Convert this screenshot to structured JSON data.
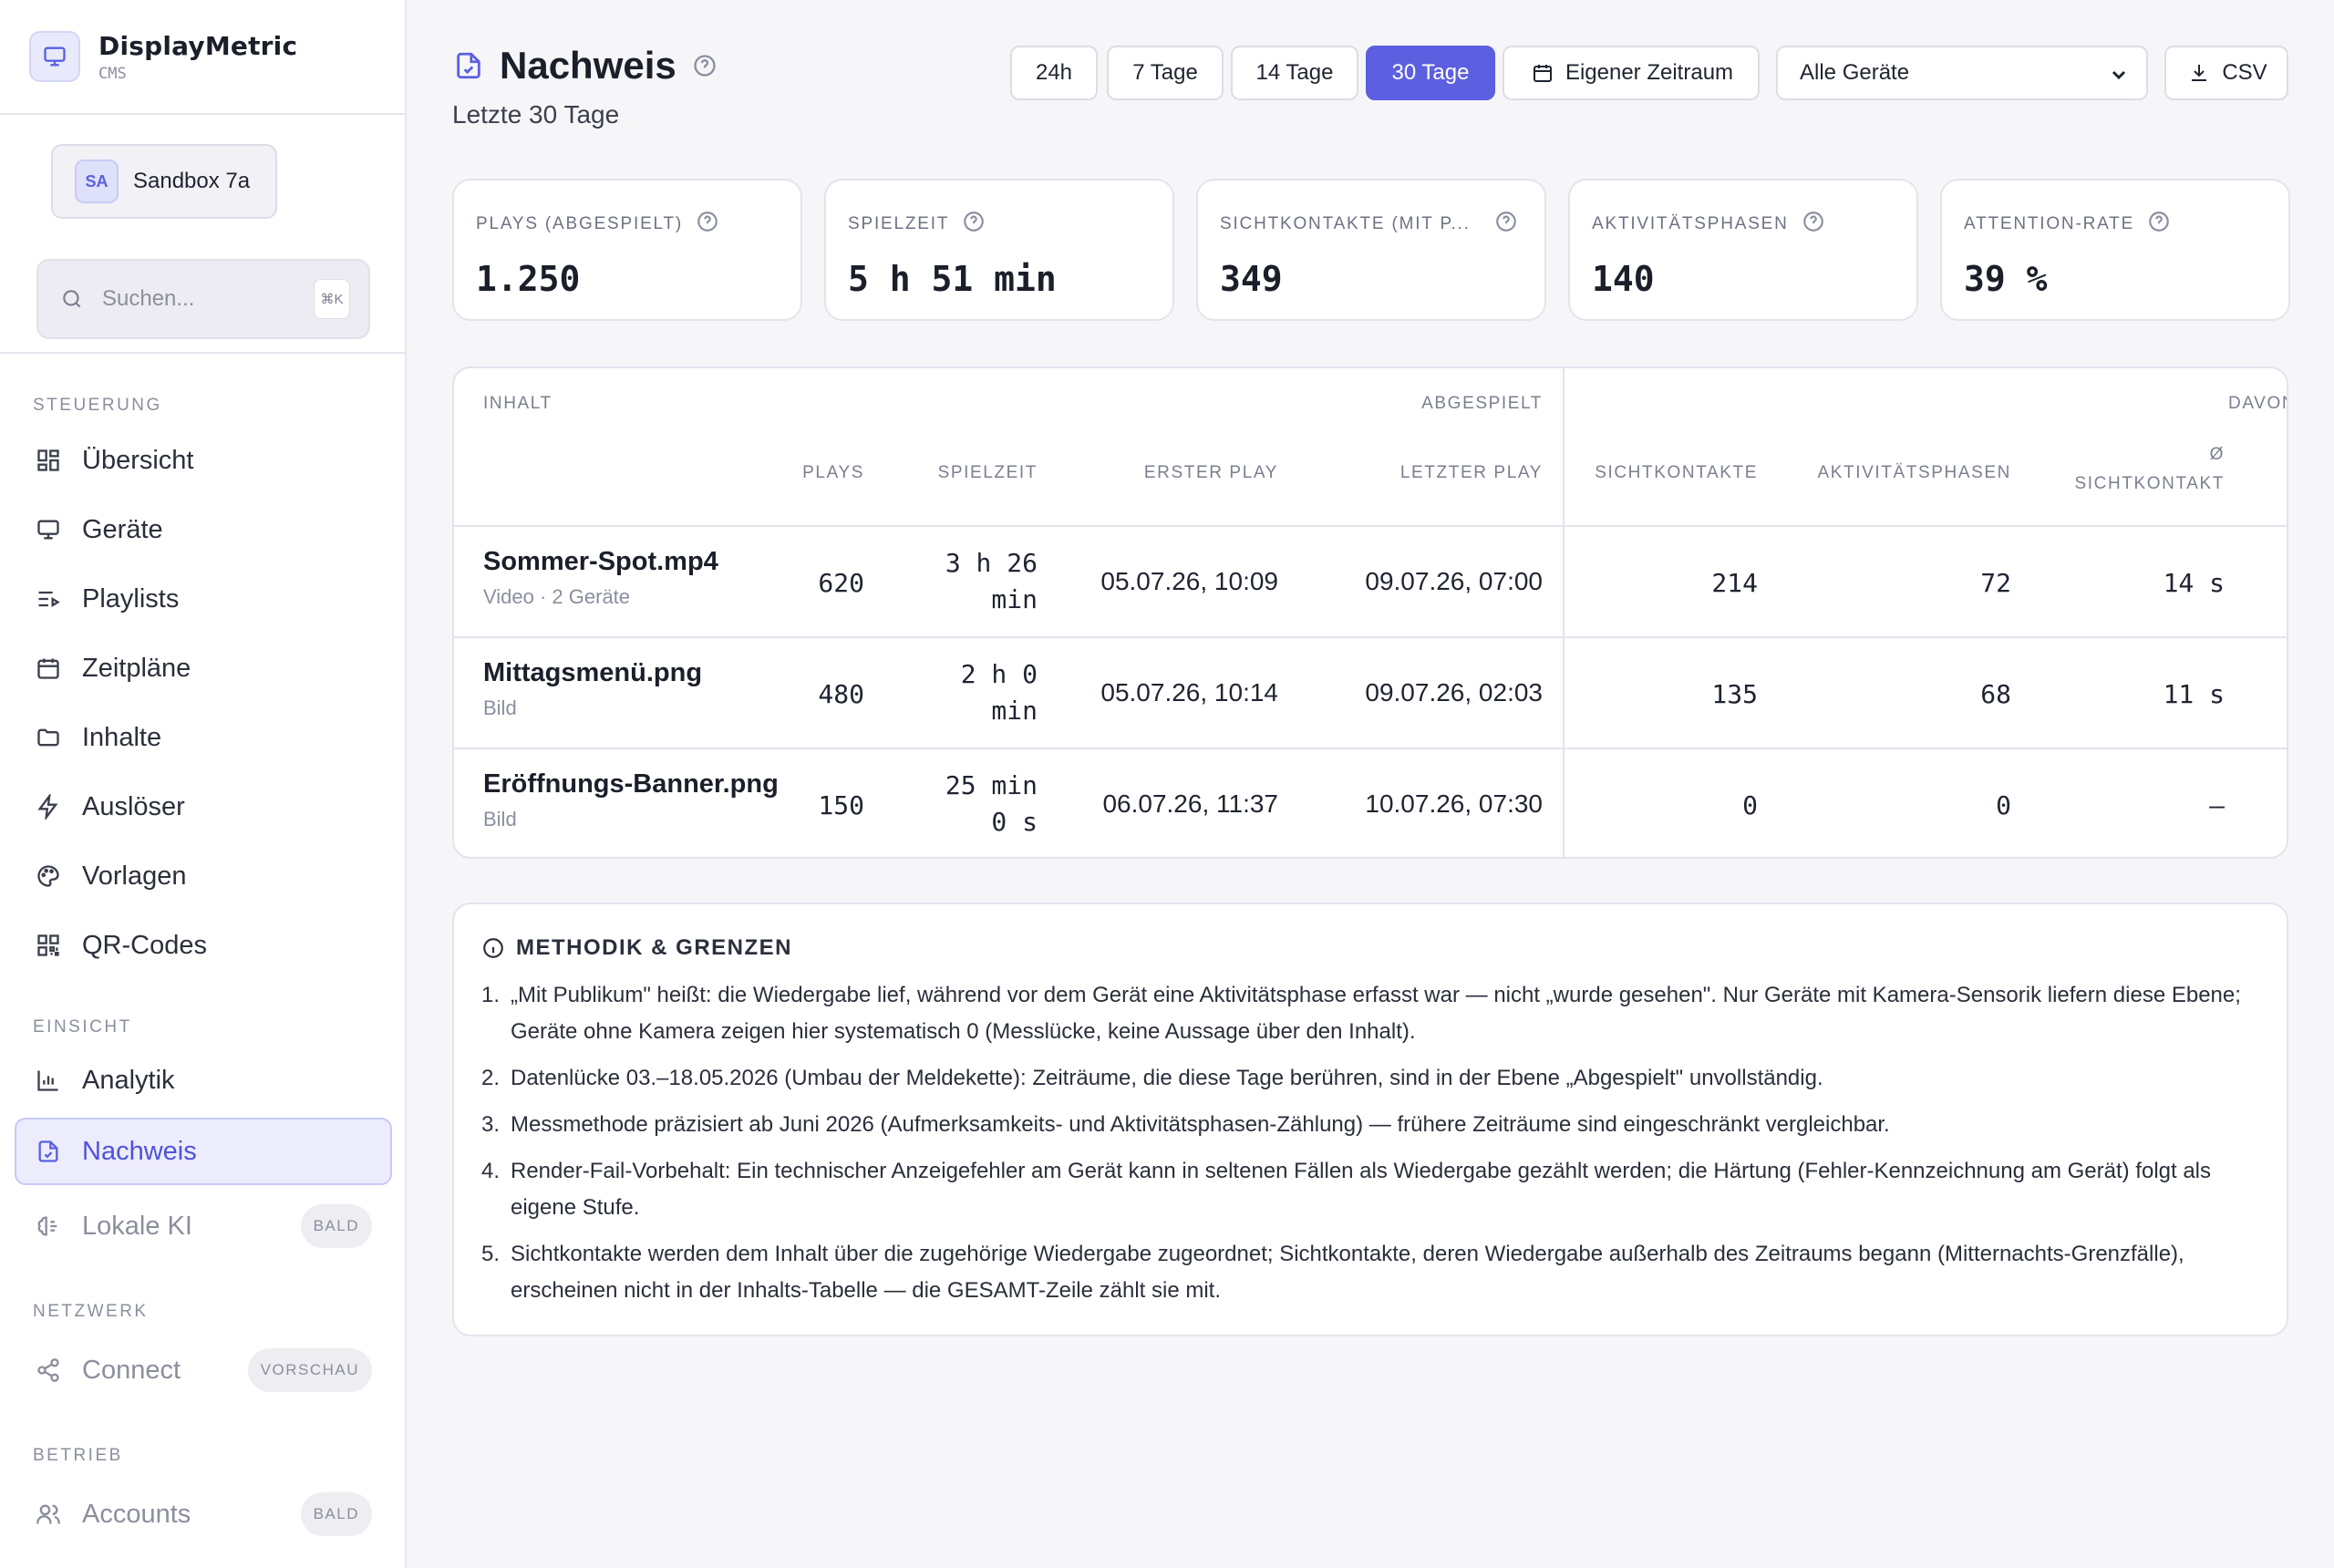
{
  "app": {
    "name": "DisplayMetric",
    "subtitle": "CMS",
    "workspace_initials": "SA",
    "workspace_name": "Sandbox 7a"
  },
  "search": {
    "placeholder": "Suchen...",
    "shortcut": "⌘K"
  },
  "sidebar": {
    "sections": [
      {
        "label": "STEUERUNG"
      },
      {
        "label": "EINSICHT"
      },
      {
        "label": "NETZWERK"
      },
      {
        "label": "BETRIEB"
      }
    ],
    "items": [
      {
        "label": "Übersicht",
        "icon": "grid-icon"
      },
      {
        "label": "Geräte",
        "icon": "monitor-icon"
      },
      {
        "label": "Playlists",
        "icon": "playlist-icon"
      },
      {
        "label": "Zeitpläne",
        "icon": "calendar-icon"
      },
      {
        "label": "Inhalte",
        "icon": "folder-icon"
      },
      {
        "label": "Auslöser",
        "icon": "lightning-icon"
      },
      {
        "label": "Vorlagen",
        "icon": "palette-icon"
      },
      {
        "label": "QR-Codes",
        "icon": "qr-icon"
      },
      {
        "label": "Analytik",
        "icon": "bar-chart-icon"
      },
      {
        "label": "Nachweis",
        "icon": "document-check-icon",
        "active": true
      },
      {
        "label": "Lokale KI",
        "icon": "brain-icon",
        "badge": "BALD"
      },
      {
        "label": "Connect",
        "icon": "share-icon",
        "badge": "VORSCHAU"
      },
      {
        "label": "Accounts",
        "icon": "users-icon",
        "badge": "BALD"
      }
    ]
  },
  "header": {
    "title": "Nachweis",
    "subtitle": "Letzte 30 Tage",
    "ranges": [
      "24h",
      "7 Tage",
      "14 Tage",
      "30 Tage"
    ],
    "active_range": "30 Tage",
    "custom_range": "Eigener Zeitraum",
    "device_filter": "Alle Geräte",
    "export": "CSV"
  },
  "kpis": [
    {
      "label": "PLAYS (ABGESPIELT)",
      "value": "1.250"
    },
    {
      "label": "SPIELZEIT",
      "value": "5 h 51 min"
    },
    {
      "label": "SICHTKONTAKTE (MIT P...",
      "value": "349"
    },
    {
      "label": "AKTIVITÄTSPHASEN",
      "value": "140"
    },
    {
      "label": "ATTENTION-RATE",
      "value": "39 %"
    }
  ],
  "table": {
    "groups": {
      "content": "INHALT",
      "played": "ABGESPIELT",
      "audience": "DAVON MIT"
    },
    "columns": {
      "plays": "PLAYS",
      "playtime": "SPIELZEIT",
      "first_play": "ERSTER PLAY",
      "last_play": "LETZTER PLAY",
      "contacts": "SICHTKONTAKTE",
      "phases": "AKTIVITÄTSPHASEN",
      "avg_contact_1": "Ø",
      "avg_contact_2": "SICHTKONTAKT"
    },
    "rows": [
      {
        "name": "Sommer-Spot.mp4",
        "meta": "Video · 2 Geräte",
        "plays": "620",
        "playtime_1": "3 h 26",
        "playtime_2": "min",
        "first_play": "05.07.26, 10:09",
        "last_play": "09.07.26, 07:00",
        "contacts": "214",
        "phases": "72",
        "avg_contact": "14 s"
      },
      {
        "name": "Mittagsmenü.png",
        "meta": "Bild",
        "plays": "480",
        "playtime_1": "2 h 0",
        "playtime_2": "min",
        "first_play": "05.07.26, 10:14",
        "last_play": "09.07.26, 02:03",
        "contacts": "135",
        "phases": "68",
        "avg_contact": "11 s"
      },
      {
        "name": "Eröffnungs-Banner.png",
        "meta": "Bild",
        "plays": "150",
        "playtime_1": "25 min",
        "playtime_2": "0 s",
        "first_play": "06.07.26, 11:37",
        "last_play": "10.07.26, 07:30",
        "contacts": "0",
        "phases": "0",
        "avg_contact": "—"
      }
    ]
  },
  "methodology": {
    "title": "METHODIK & GRENZEN",
    "items": [
      "„Mit Publikum\" heißt: die Wiedergabe lief, während vor dem Gerät eine Aktivitätsphase erfasst war — nicht „wurde gesehen\". Nur Geräte mit Kamera-Sensorik liefern diese Ebene; Geräte ohne Kamera zeigen hier systematisch 0 (Messlücke, keine Aussage über den Inhalt).",
      "Datenlücke 03.–18.05.2026 (Umbau der Meldekette): Zeiträume, die diese Tage berühren, sind in der Ebene „Abgespielt\" unvollständig.",
      "Messmethode präzisiert ab Juni 2026 (Aufmerksamkeits- und Aktivitätsphasen-Zählung) — frühere Zeiträume sind eingeschränkt vergleichbar.",
      "Render-Fail-Vorbehalt: Ein technischer Anzeigefehler am Gerät kann in seltenen Fällen als Wiedergabe gezählt werden; die Härtung (Fehler-Kennzeichnung am Gerät) folgt als eigene Stufe.",
      "Sichtkontakte werden dem Inhalt über die zugehörige Wiedergabe zugeordnet; Sichtkontakte, deren Wiedergabe außerhalb des Zeitraums begann (Mitternachts-Grenzfälle), erscheinen nicht in der Inhalts-Tabelle — die GESAMT-Zeile zählt sie mit."
    ]
  },
  "colors": {
    "accent": "#5b5fe0",
    "active_bg": "#ececfd",
    "border": "#e3e4ec",
    "background": "#f6f6f9"
  }
}
